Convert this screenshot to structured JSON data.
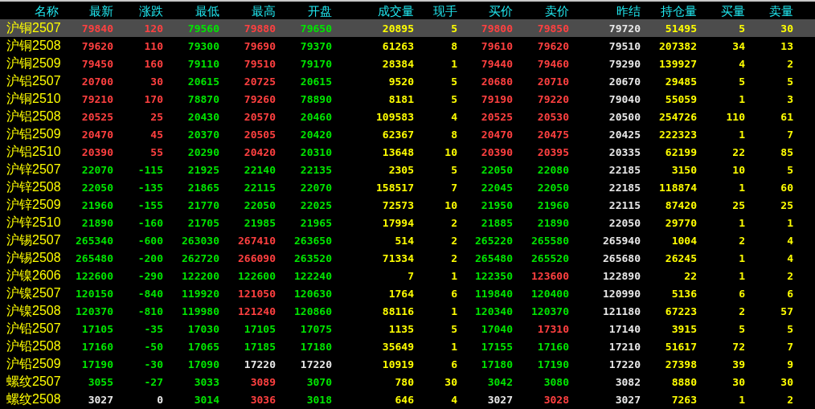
{
  "columns": [
    {
      "label": "名称",
      "kind": "name"
    },
    {
      "label": "最新",
      "kind": "price"
    },
    {
      "label": "涨跌",
      "kind": "price"
    },
    {
      "label": "最低",
      "kind": "price"
    },
    {
      "label": "最高",
      "kind": "price"
    },
    {
      "label": "开盘",
      "kind": "price"
    },
    {
      "label": "成交量",
      "kind": "qty"
    },
    {
      "label": "现手",
      "kind": "qty"
    },
    {
      "label": "买价",
      "kind": "price"
    },
    {
      "label": "卖价",
      "kind": "price"
    },
    {
      "label": "昨结",
      "kind": "settle"
    },
    {
      "label": "持仓量",
      "kind": "qty"
    },
    {
      "label": "买量",
      "kind": "qty"
    },
    {
      "label": "卖量",
      "kind": "qty"
    }
  ],
  "rows": [
    {
      "selected": true,
      "cells": [
        {
          "text": "沪铜2507"
        },
        {
          "text": "79840",
          "color": "#ff4040"
        },
        {
          "text": "120",
          "color": "#ff4040"
        },
        {
          "text": "79560",
          "color": "#00e600"
        },
        {
          "text": "79880",
          "color": "#ff4040"
        },
        {
          "text": "79650",
          "color": "#00e600"
        },
        {
          "text": "20895"
        },
        {
          "text": "5"
        },
        {
          "text": "79800",
          "color": "#ff4040"
        },
        {
          "text": "79850",
          "color": "#ff4040"
        },
        {
          "text": "79720"
        },
        {
          "text": "51495"
        },
        {
          "text": "5"
        },
        {
          "text": "30"
        }
      ]
    },
    {
      "selected": false,
      "cells": [
        {
          "text": "沪铜2508"
        },
        {
          "text": "79620",
          "color": "#ff4040"
        },
        {
          "text": "110",
          "color": "#ff4040"
        },
        {
          "text": "79300",
          "color": "#00e600"
        },
        {
          "text": "79690",
          "color": "#ff4040"
        },
        {
          "text": "79370",
          "color": "#00e600"
        },
        {
          "text": "61263"
        },
        {
          "text": "8"
        },
        {
          "text": "79610",
          "color": "#ff4040"
        },
        {
          "text": "79620",
          "color": "#ff4040"
        },
        {
          "text": "79510"
        },
        {
          "text": "207382"
        },
        {
          "text": "34"
        },
        {
          "text": "13"
        }
      ]
    },
    {
      "selected": false,
      "cells": [
        {
          "text": "沪铜2509"
        },
        {
          "text": "79450",
          "color": "#ff4040"
        },
        {
          "text": "160",
          "color": "#ff4040"
        },
        {
          "text": "79110",
          "color": "#00e600"
        },
        {
          "text": "79510",
          "color": "#ff4040"
        },
        {
          "text": "79170",
          "color": "#00e600"
        },
        {
          "text": "28384"
        },
        {
          "text": "1"
        },
        {
          "text": "79440",
          "color": "#ff4040"
        },
        {
          "text": "79460",
          "color": "#ff4040"
        },
        {
          "text": "79290"
        },
        {
          "text": "139927"
        },
        {
          "text": "4"
        },
        {
          "text": "2"
        }
      ]
    },
    {
      "selected": false,
      "cells": [
        {
          "text": "沪铝2507"
        },
        {
          "text": "20700",
          "color": "#ff4040"
        },
        {
          "text": "30",
          "color": "#ff4040"
        },
        {
          "text": "20615",
          "color": "#00e600"
        },
        {
          "text": "20725",
          "color": "#ff4040"
        },
        {
          "text": "20615",
          "color": "#00e600"
        },
        {
          "text": "9520"
        },
        {
          "text": "5"
        },
        {
          "text": "20680",
          "color": "#ff4040"
        },
        {
          "text": "20710",
          "color": "#ff4040"
        },
        {
          "text": "20670"
        },
        {
          "text": "29485"
        },
        {
          "text": "5"
        },
        {
          "text": "5"
        }
      ]
    },
    {
      "selected": false,
      "cells": [
        {
          "text": "沪铜2510"
        },
        {
          "text": "79210",
          "color": "#ff4040"
        },
        {
          "text": "170",
          "color": "#ff4040"
        },
        {
          "text": "78870",
          "color": "#00e600"
        },
        {
          "text": "79260",
          "color": "#ff4040"
        },
        {
          "text": "78890",
          "color": "#00e600"
        },
        {
          "text": "8181"
        },
        {
          "text": "5"
        },
        {
          "text": "79190",
          "color": "#ff4040"
        },
        {
          "text": "79220",
          "color": "#ff4040"
        },
        {
          "text": "79040"
        },
        {
          "text": "55059"
        },
        {
          "text": "1"
        },
        {
          "text": "3"
        }
      ]
    },
    {
      "selected": false,
      "cells": [
        {
          "text": "沪铝2508"
        },
        {
          "text": "20525",
          "color": "#ff4040"
        },
        {
          "text": "25",
          "color": "#ff4040"
        },
        {
          "text": "20430",
          "color": "#00e600"
        },
        {
          "text": "20570",
          "color": "#ff4040"
        },
        {
          "text": "20460",
          "color": "#00e600"
        },
        {
          "text": "109583"
        },
        {
          "text": "4"
        },
        {
          "text": "20525",
          "color": "#ff4040"
        },
        {
          "text": "20530",
          "color": "#ff4040"
        },
        {
          "text": "20500"
        },
        {
          "text": "254726"
        },
        {
          "text": "110"
        },
        {
          "text": "61"
        }
      ]
    },
    {
      "selected": false,
      "cells": [
        {
          "text": "沪铝2509"
        },
        {
          "text": "20470",
          "color": "#ff4040"
        },
        {
          "text": "45",
          "color": "#ff4040"
        },
        {
          "text": "20370",
          "color": "#00e600"
        },
        {
          "text": "20505",
          "color": "#ff4040"
        },
        {
          "text": "20420",
          "color": "#00e600"
        },
        {
          "text": "62367"
        },
        {
          "text": "8"
        },
        {
          "text": "20470",
          "color": "#ff4040"
        },
        {
          "text": "20475",
          "color": "#ff4040"
        },
        {
          "text": "20425"
        },
        {
          "text": "222323"
        },
        {
          "text": "1"
        },
        {
          "text": "7"
        }
      ]
    },
    {
      "selected": false,
      "cells": [
        {
          "text": "沪铝2510"
        },
        {
          "text": "20390",
          "color": "#ff4040"
        },
        {
          "text": "55",
          "color": "#ff4040"
        },
        {
          "text": "20290",
          "color": "#00e600"
        },
        {
          "text": "20420",
          "color": "#ff4040"
        },
        {
          "text": "20310",
          "color": "#00e600"
        },
        {
          "text": "13648"
        },
        {
          "text": "10"
        },
        {
          "text": "20390",
          "color": "#ff4040"
        },
        {
          "text": "20395",
          "color": "#ff4040"
        },
        {
          "text": "20335"
        },
        {
          "text": "62199"
        },
        {
          "text": "22"
        },
        {
          "text": "85"
        }
      ]
    },
    {
      "selected": false,
      "cells": [
        {
          "text": "沪锌2507"
        },
        {
          "text": "22070",
          "color": "#00e600"
        },
        {
          "text": "-115",
          "color": "#00e600"
        },
        {
          "text": "21925",
          "color": "#00e600"
        },
        {
          "text": "22140",
          "color": "#00e600"
        },
        {
          "text": "22135",
          "color": "#00e600"
        },
        {
          "text": "2305"
        },
        {
          "text": "5"
        },
        {
          "text": "22050",
          "color": "#00e600"
        },
        {
          "text": "22080",
          "color": "#00e600"
        },
        {
          "text": "22185"
        },
        {
          "text": "3150"
        },
        {
          "text": "10"
        },
        {
          "text": "5"
        }
      ]
    },
    {
      "selected": false,
      "cells": [
        {
          "text": "沪锌2508"
        },
        {
          "text": "22050",
          "color": "#00e600"
        },
        {
          "text": "-135",
          "color": "#00e600"
        },
        {
          "text": "21865",
          "color": "#00e600"
        },
        {
          "text": "22115",
          "color": "#00e600"
        },
        {
          "text": "22070",
          "color": "#00e600"
        },
        {
          "text": "158517"
        },
        {
          "text": "7"
        },
        {
          "text": "22045",
          "color": "#00e600"
        },
        {
          "text": "22050",
          "color": "#00e600"
        },
        {
          "text": "22185"
        },
        {
          "text": "118874"
        },
        {
          "text": "1"
        },
        {
          "text": "60"
        }
      ]
    },
    {
      "selected": false,
      "cells": [
        {
          "text": "沪锌2509"
        },
        {
          "text": "21960",
          "color": "#00e600"
        },
        {
          "text": "-155",
          "color": "#00e600"
        },
        {
          "text": "21770",
          "color": "#00e600"
        },
        {
          "text": "22050",
          "color": "#00e600"
        },
        {
          "text": "22025",
          "color": "#00e600"
        },
        {
          "text": "72573"
        },
        {
          "text": "10"
        },
        {
          "text": "21950",
          "color": "#00e600"
        },
        {
          "text": "21960",
          "color": "#00e600"
        },
        {
          "text": "22115"
        },
        {
          "text": "87420"
        },
        {
          "text": "25"
        },
        {
          "text": "25"
        }
      ]
    },
    {
      "selected": false,
      "cells": [
        {
          "text": "沪锌2510"
        },
        {
          "text": "21890",
          "color": "#00e600"
        },
        {
          "text": "-160",
          "color": "#00e600"
        },
        {
          "text": "21705",
          "color": "#00e600"
        },
        {
          "text": "21985",
          "color": "#00e600"
        },
        {
          "text": "21965",
          "color": "#00e600"
        },
        {
          "text": "17994"
        },
        {
          "text": "2"
        },
        {
          "text": "21885",
          "color": "#00e600"
        },
        {
          "text": "21890",
          "color": "#00e600"
        },
        {
          "text": "22050"
        },
        {
          "text": "29770"
        },
        {
          "text": "1"
        },
        {
          "text": "1"
        }
      ]
    },
    {
      "selected": false,
      "cells": [
        {
          "text": "沪锡2507"
        },
        {
          "text": "265340",
          "color": "#00e600"
        },
        {
          "text": "-600",
          "color": "#00e600"
        },
        {
          "text": "263030",
          "color": "#00e600"
        },
        {
          "text": "267410",
          "color": "#ff4040"
        },
        {
          "text": "263650",
          "color": "#00e600"
        },
        {
          "text": "514"
        },
        {
          "text": "2"
        },
        {
          "text": "265220",
          "color": "#00e600"
        },
        {
          "text": "265580",
          "color": "#00e600"
        },
        {
          "text": "265940"
        },
        {
          "text": "1004"
        },
        {
          "text": "2"
        },
        {
          "text": "4"
        }
      ]
    },
    {
      "selected": false,
      "cells": [
        {
          "text": "沪锡2508"
        },
        {
          "text": "265480",
          "color": "#00e600"
        },
        {
          "text": "-200",
          "color": "#00e600"
        },
        {
          "text": "262720",
          "color": "#00e600"
        },
        {
          "text": "266090",
          "color": "#ff4040"
        },
        {
          "text": "263520",
          "color": "#00e600"
        },
        {
          "text": "71334"
        },
        {
          "text": "2"
        },
        {
          "text": "265480",
          "color": "#00e600"
        },
        {
          "text": "265520",
          "color": "#00e600"
        },
        {
          "text": "265680"
        },
        {
          "text": "26245"
        },
        {
          "text": "1"
        },
        {
          "text": "4"
        }
      ]
    },
    {
      "selected": false,
      "cells": [
        {
          "text": "沪镍2606"
        },
        {
          "text": "122600",
          "color": "#00e600"
        },
        {
          "text": "-290",
          "color": "#00e600"
        },
        {
          "text": "122200",
          "color": "#00e600"
        },
        {
          "text": "122600",
          "color": "#00e600"
        },
        {
          "text": "122240",
          "color": "#00e600"
        },
        {
          "text": "7"
        },
        {
          "text": "1"
        },
        {
          "text": "122350",
          "color": "#00e600"
        },
        {
          "text": "123600",
          "color": "#ff4040"
        },
        {
          "text": "122890"
        },
        {
          "text": "22"
        },
        {
          "text": "1"
        },
        {
          "text": "2"
        }
      ]
    },
    {
      "selected": false,
      "cells": [
        {
          "text": "沪镍2507"
        },
        {
          "text": "120150",
          "color": "#00e600"
        },
        {
          "text": "-840",
          "color": "#00e600"
        },
        {
          "text": "119920",
          "color": "#00e600"
        },
        {
          "text": "121050",
          "color": "#ff4040"
        },
        {
          "text": "120630",
          "color": "#00e600"
        },
        {
          "text": "1764"
        },
        {
          "text": "6"
        },
        {
          "text": "119840",
          "color": "#00e600"
        },
        {
          "text": "120400",
          "color": "#00e600"
        },
        {
          "text": "120990"
        },
        {
          "text": "5136"
        },
        {
          "text": "6"
        },
        {
          "text": "6"
        }
      ]
    },
    {
      "selected": false,
      "cells": [
        {
          "text": "沪镍2508"
        },
        {
          "text": "120370",
          "color": "#00e600"
        },
        {
          "text": "-810",
          "color": "#00e600"
        },
        {
          "text": "119980",
          "color": "#00e600"
        },
        {
          "text": "121240",
          "color": "#ff4040"
        },
        {
          "text": "120860",
          "color": "#00e600"
        },
        {
          "text": "88116"
        },
        {
          "text": "1"
        },
        {
          "text": "120340",
          "color": "#00e600"
        },
        {
          "text": "120370",
          "color": "#00e600"
        },
        {
          "text": "121180"
        },
        {
          "text": "67223"
        },
        {
          "text": "2"
        },
        {
          "text": "57"
        }
      ]
    },
    {
      "selected": false,
      "cells": [
        {
          "text": "沪铅2507"
        },
        {
          "text": "17105",
          "color": "#00e600"
        },
        {
          "text": "-35",
          "color": "#00e600"
        },
        {
          "text": "17030",
          "color": "#00e600"
        },
        {
          "text": "17105",
          "color": "#00e600"
        },
        {
          "text": "17075",
          "color": "#00e600"
        },
        {
          "text": "1135"
        },
        {
          "text": "5"
        },
        {
          "text": "17040",
          "color": "#00e600"
        },
        {
          "text": "17310",
          "color": "#ff4040"
        },
        {
          "text": "17140"
        },
        {
          "text": "3915"
        },
        {
          "text": "5"
        },
        {
          "text": "5"
        }
      ]
    },
    {
      "selected": false,
      "cells": [
        {
          "text": "沪铅2508"
        },
        {
          "text": "17160",
          "color": "#00e600"
        },
        {
          "text": "-50",
          "color": "#00e600"
        },
        {
          "text": "17065",
          "color": "#00e600"
        },
        {
          "text": "17185",
          "color": "#00e600"
        },
        {
          "text": "17180",
          "color": "#00e600"
        },
        {
          "text": "35649"
        },
        {
          "text": "1"
        },
        {
          "text": "17155",
          "color": "#00e600"
        },
        {
          "text": "17160",
          "color": "#00e600"
        },
        {
          "text": "17210"
        },
        {
          "text": "51617"
        },
        {
          "text": "72"
        },
        {
          "text": "7"
        }
      ]
    },
    {
      "selected": false,
      "cells": [
        {
          "text": "沪铅2509"
        },
        {
          "text": "17190",
          "color": "#00e600"
        },
        {
          "text": "-30",
          "color": "#00e600"
        },
        {
          "text": "17090",
          "color": "#00e600"
        },
        {
          "text": "17220",
          "color": "#e8e8e8"
        },
        {
          "text": "17220",
          "color": "#e8e8e8"
        },
        {
          "text": "10919"
        },
        {
          "text": "6"
        },
        {
          "text": "17180",
          "color": "#00e600"
        },
        {
          "text": "17190",
          "color": "#00e600"
        },
        {
          "text": "17220"
        },
        {
          "text": "27398"
        },
        {
          "text": "39"
        },
        {
          "text": "9"
        }
      ]
    },
    {
      "selected": false,
      "cells": [
        {
          "text": "螺纹2507"
        },
        {
          "text": "3055",
          "color": "#00e600"
        },
        {
          "text": "-27",
          "color": "#00e600"
        },
        {
          "text": "3033",
          "color": "#00e600"
        },
        {
          "text": "3089",
          "color": "#ff4040"
        },
        {
          "text": "3070",
          "color": "#00e600"
        },
        {
          "text": "780"
        },
        {
          "text": "30"
        },
        {
          "text": "3042",
          "color": "#00e600"
        },
        {
          "text": "3080",
          "color": "#00e600"
        },
        {
          "text": "3082"
        },
        {
          "text": "8880"
        },
        {
          "text": "30"
        },
        {
          "text": "30"
        }
      ]
    },
    {
      "selected": false,
      "cells": [
        {
          "text": "螺纹2508"
        },
        {
          "text": "3027",
          "color": "#e8e8e8"
        },
        {
          "text": "0",
          "color": "#e8e8e8"
        },
        {
          "text": "3014",
          "color": "#00e600"
        },
        {
          "text": "3036",
          "color": "#ff4040"
        },
        {
          "text": "3018",
          "color": "#00e600"
        },
        {
          "text": "646"
        },
        {
          "text": "4"
        },
        {
          "text": "3027",
          "color": "#e8e8e8"
        },
        {
          "text": "3028",
          "color": "#ff4040"
        },
        {
          "text": "3027"
        },
        {
          "text": "7263"
        },
        {
          "text": "1"
        },
        {
          "text": "2"
        }
      ]
    }
  ]
}
